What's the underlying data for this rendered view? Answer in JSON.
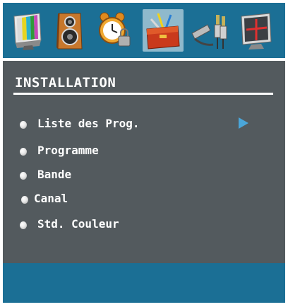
{
  "toolbar": {
    "icons": [
      {
        "name": "picture-icon",
        "selected": false
      },
      {
        "name": "sound-icon",
        "selected": false
      },
      {
        "name": "timer-lock-icon",
        "selected": false
      },
      {
        "name": "installation-toolbox-icon",
        "selected": true
      },
      {
        "name": "source-connectors-icon",
        "selected": false
      },
      {
        "name": "pc-features-icon",
        "selected": false
      }
    ]
  },
  "panel": {
    "title": "INSTALLATION",
    "items": [
      {
        "label": "Liste des Prog.",
        "has_submenu": true
      },
      {
        "label": "Programme"
      },
      {
        "label": "Bande"
      },
      {
        "label": "Canal"
      },
      {
        "label": "Std. Couleur"
      }
    ]
  },
  "colors": {
    "bar": "#1b6f95",
    "panel": "#535a5e",
    "selected_icon_bg": "#8fb9cc",
    "submenu_arrow": "#4aa6d9"
  }
}
